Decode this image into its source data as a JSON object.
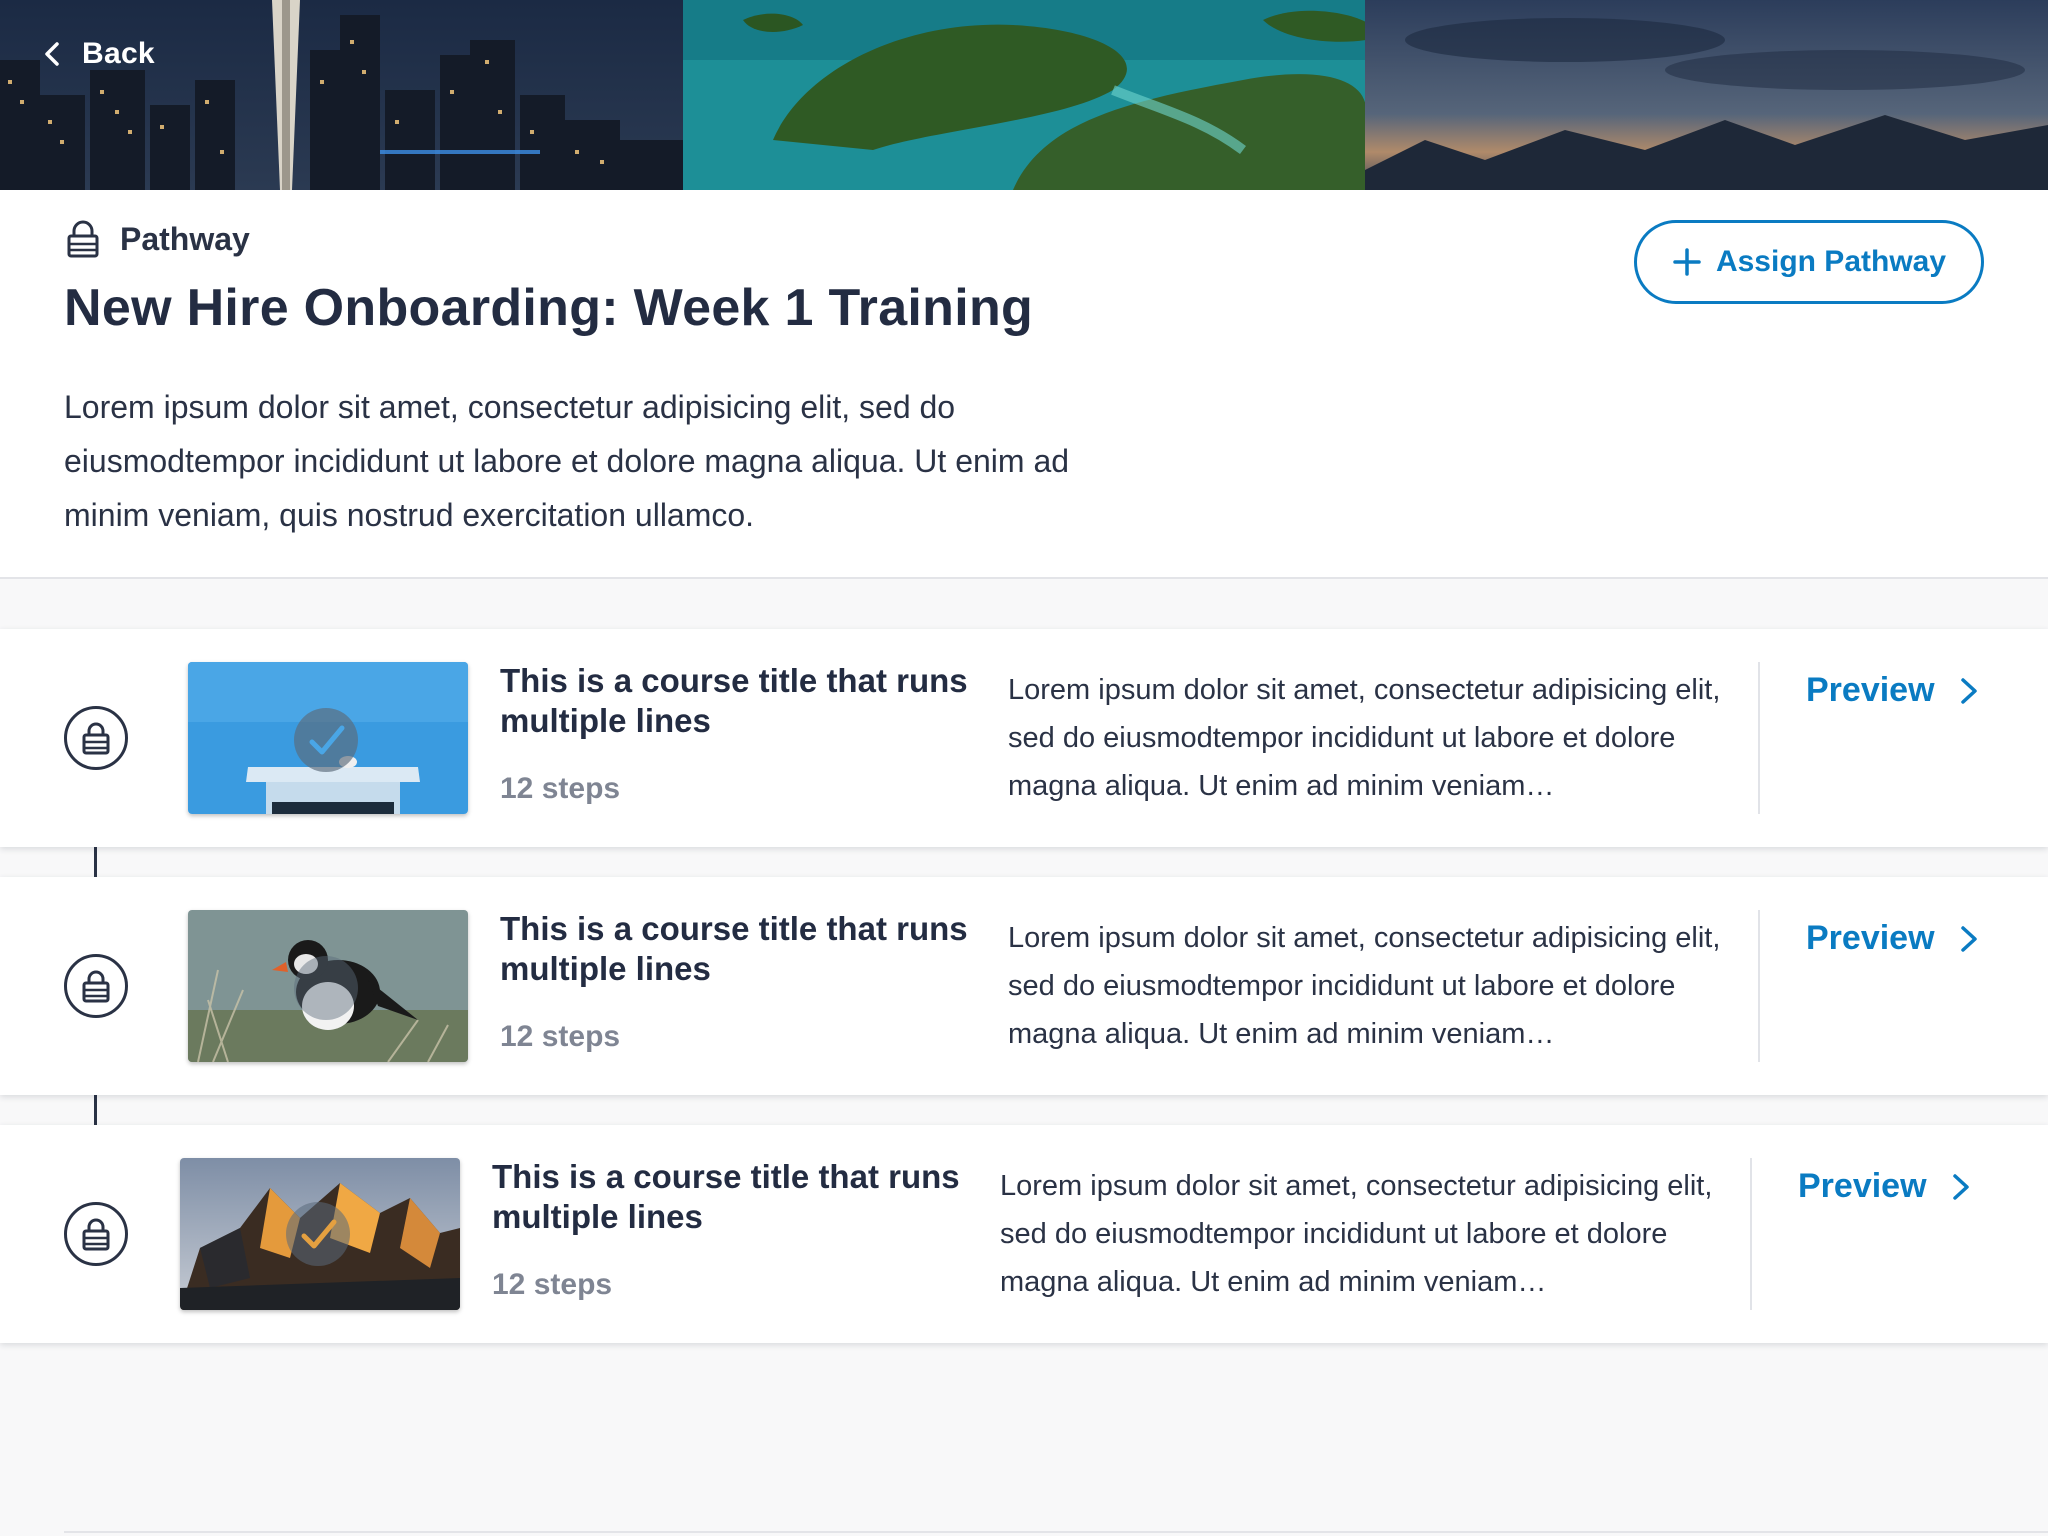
{
  "nav": {
    "back_label": "Back"
  },
  "header": {
    "eyebrow": "Pathway",
    "title": "New Hire Onboarding: Week 1 Training",
    "description": "Lorem ipsum dolor sit amet, consectetur adipisicing elit, sed do eiusmodtempor incididunt ut labore et dolore magna aliqua. Ut enim ad minim veniam, quis nostrud exercitation ullamco.",
    "assign_label": "Assign Pathway"
  },
  "courses": [
    {
      "title": "This is a course title that runs multiple lines",
      "steps": "12 steps",
      "description": "Lorem ipsum dolor sit amet, consectetur adipisicing elit, sed do eiusmodtempor incididunt ut labore et dolore magna aliqua. Ut enim ad minim veniam…",
      "preview_label": "Preview",
      "status": "locked"
    },
    {
      "title": "This is a course title that runs multiple lines",
      "steps": "12 steps",
      "description": "Lorem ipsum dolor sit amet, consectetur adipisicing elit, sed do eiusmodtempor incididunt ut labore et dolore magna aliqua. Ut enim ad minim veniam…",
      "preview_label": "Preview",
      "status": "locked"
    },
    {
      "title": "This is a course title that runs multiple lines",
      "steps": "12 steps",
      "description": "Lorem ipsum dolor sit amet, consectetur adipisicing elit, sed do eiusmodtempor incididunt ut labore et dolore magna aliqua. Ut enim ad minim veniam…",
      "preview_label": "Preview",
      "status": "locked"
    }
  ],
  "colors": {
    "accent": "#0a7bc2",
    "text_primary": "#232c42",
    "text_muted": "#7f8593",
    "background": "#f8f8f9"
  },
  "icons": [
    "chevron-left-icon",
    "lock-icon",
    "plus-icon",
    "chevron-right-icon",
    "checkmark-icon"
  ]
}
